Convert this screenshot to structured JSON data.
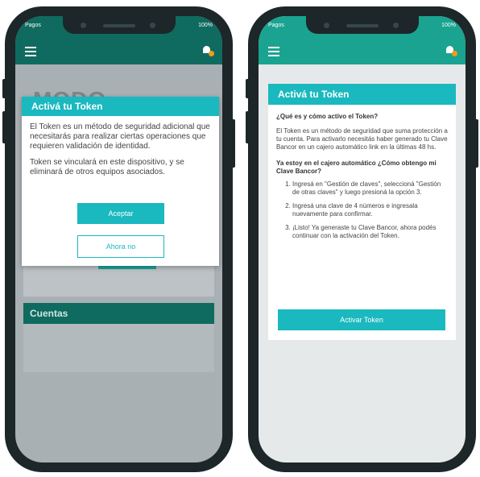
{
  "status_bar": {
    "carrier": "Pagos",
    "battery": "100%"
  },
  "left": {
    "background_title": "MODO",
    "section_title": "Cuentas",
    "modal": {
      "title": "Activá tu Token",
      "paragraph1": "El Token es un método de seguridad adicional que necesitarás para realizar ciertas operaciones que requieren validación de identidad.",
      "paragraph2": "Token se vinculará en este dispositivo, y se eliminará de otros equipos asociados.",
      "accept_label": "Aceptar",
      "later_label": "Ahora no"
    }
  },
  "right": {
    "title": "Activá tu Token",
    "question1": "¿Qué es y cómo activo el Token?",
    "paragraph1": "El Token es un método de seguridad que suma protección a tu cuenta. Para activarlo necesitás haber generado tu Clave Bancor en un cajero automático link en la últimas 48 hs.",
    "question2": "Ya estoy en el cajero automático ¿Cómo obtengo mi Clave Bancor?",
    "steps": [
      "Ingresá en \"Gestión de claves\", seleccioná \"Gestión de otras claves\" y luego presioná la opción 3.",
      "Ingresá una clave de 4 números e ingresala nuevamente para confirmar.",
      "¡Listo! Ya generaste tu Clave Bancor, ahora podés continuar con la activación del Token."
    ],
    "activate_label": "Activar Token"
  },
  "colors": {
    "accent": "#1ab8bf",
    "dark_green": "#0f6b5f",
    "notification": "#f39c12"
  }
}
